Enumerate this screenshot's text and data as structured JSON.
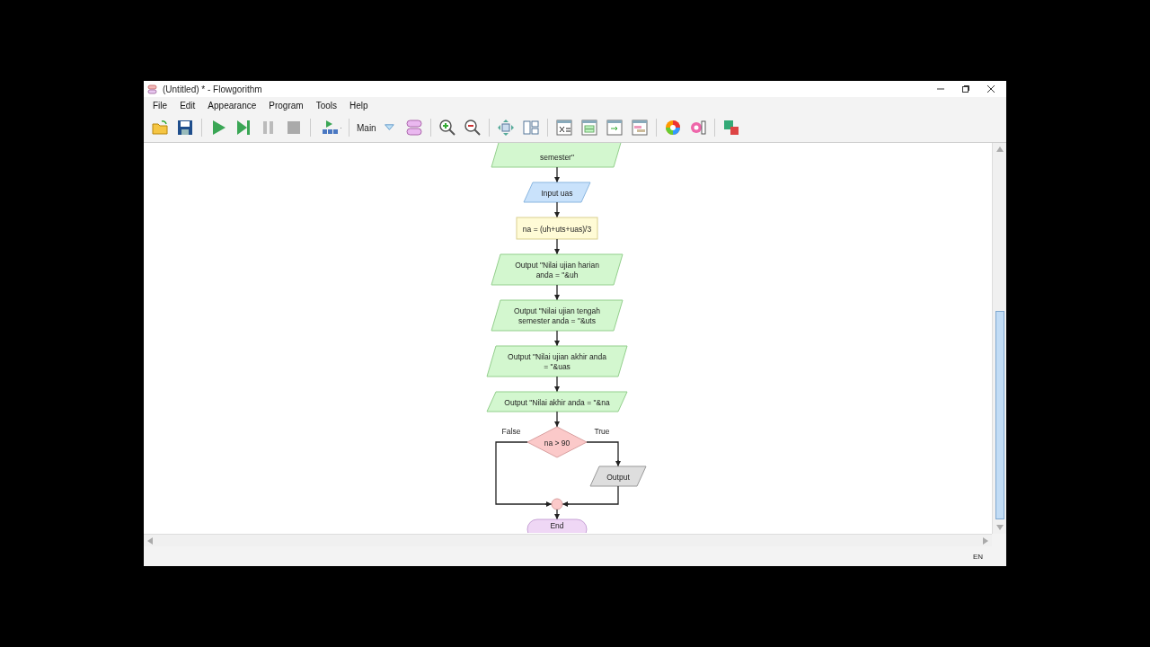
{
  "window": {
    "title": "(Untitled) * - Flowgorithm"
  },
  "menu": [
    "File",
    "Edit",
    "Appearance",
    "Program",
    "Tools",
    "Help"
  ],
  "toolbar": {
    "function_selector": "Main"
  },
  "flowchart": {
    "nodes": [
      {
        "kind": "output",
        "cut_top": true,
        "lines": [
          "semester\""
        ]
      },
      {
        "kind": "input",
        "lines": [
          "Input uas"
        ]
      },
      {
        "kind": "process",
        "lines": [
          "na = (uh+uts+uas)/3"
        ]
      },
      {
        "kind": "output",
        "lines": [
          "Output \"Nilai ujian harian",
          "anda = \"&uh"
        ]
      },
      {
        "kind": "output",
        "lines": [
          "Output \"Nilai ujian tengah",
          "semester anda = \"&uts"
        ]
      },
      {
        "kind": "output",
        "lines": [
          "Output \"Nilai ujian akhir anda",
          "= \"&uas"
        ]
      },
      {
        "kind": "output",
        "lines": [
          "Output \"Nilai akhir anda = \"&na"
        ]
      },
      {
        "kind": "decision",
        "condition": "na > 90",
        "false_label": "False",
        "true_label": "True",
        "true_branch": [
          {
            "kind": "blank_output",
            "lines": [
              "Output"
            ]
          }
        ]
      },
      {
        "kind": "terminal",
        "lines": [
          "End"
        ]
      }
    ]
  },
  "status_bar": {
    "language": "EN"
  }
}
